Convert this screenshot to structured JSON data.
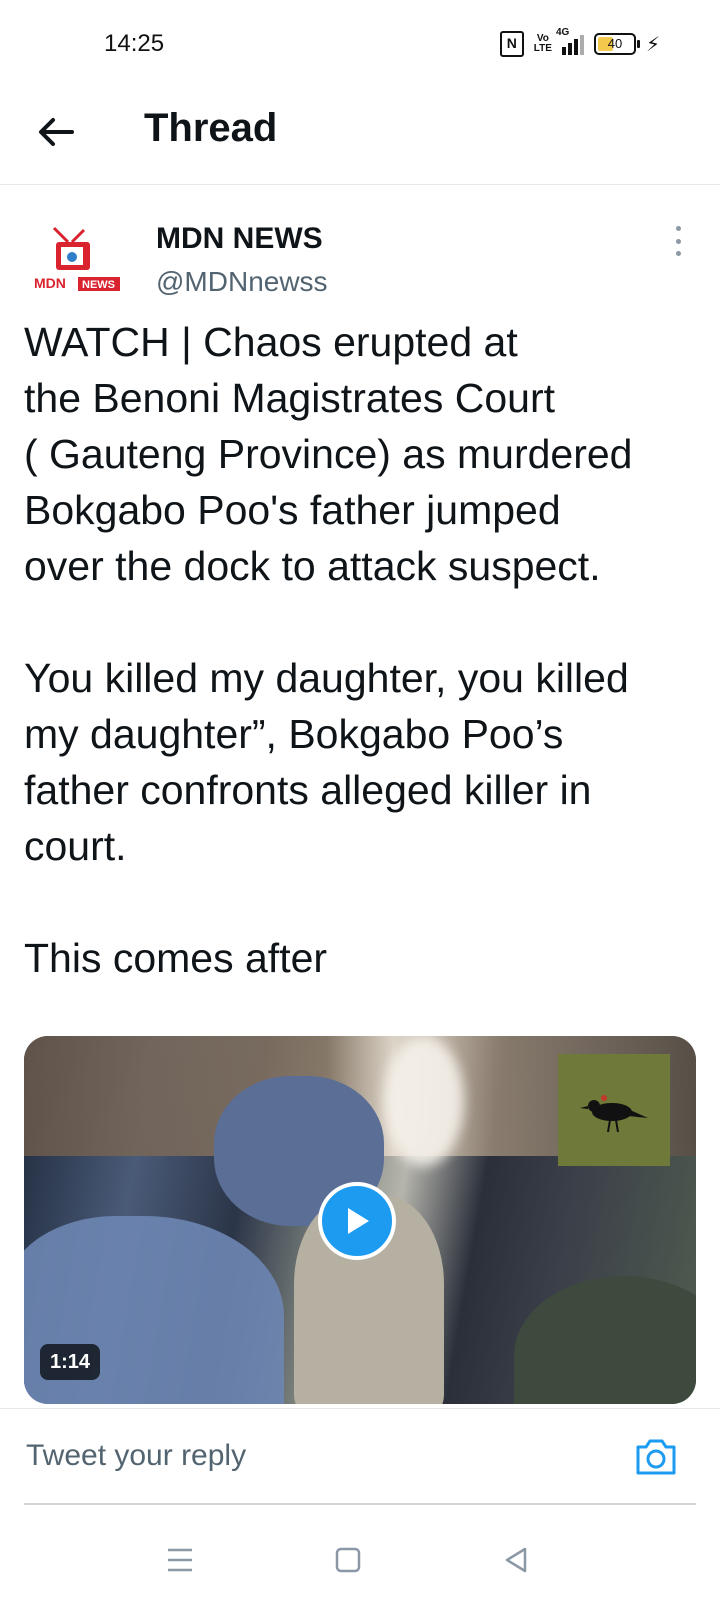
{
  "status_bar": {
    "time": "14:25",
    "nfc": "N",
    "volte": "Vo\nLTE",
    "network": "4G",
    "battery_level": "40"
  },
  "header": {
    "back_icon": "arrow-left-icon",
    "title": "Thread"
  },
  "tweet": {
    "author_name": "MDN NEWS",
    "author_handle": "@MDNnewss",
    "avatar_text": "MDN",
    "avatar_badge": "NEWS",
    "text": "WATCH | Chaos erupted at\nthe Benoni Magistrates Court\n( Gauteng Province) as murdered\nBokgabo Poo's father jumped\nover the dock to attack suspect.\n\nYou killed my daughter, you killed\nmy daughter”, Bokgabo Poo’s\nfather confronts alleged killer in\ncourt.\n\nThis comes after",
    "video_duration": "1:14"
  },
  "reply": {
    "placeholder": "Tweet your reply",
    "camera_icon": "camera-icon"
  },
  "colors": {
    "accent": "#1d9bf0",
    "text": "#0f1419",
    "secondary_text": "#536471",
    "divider": "#e6e9ec"
  },
  "nav": {
    "menu_icon": "menu-icon",
    "home_icon": "square-home-icon",
    "back_icon": "triangle-back-icon"
  }
}
